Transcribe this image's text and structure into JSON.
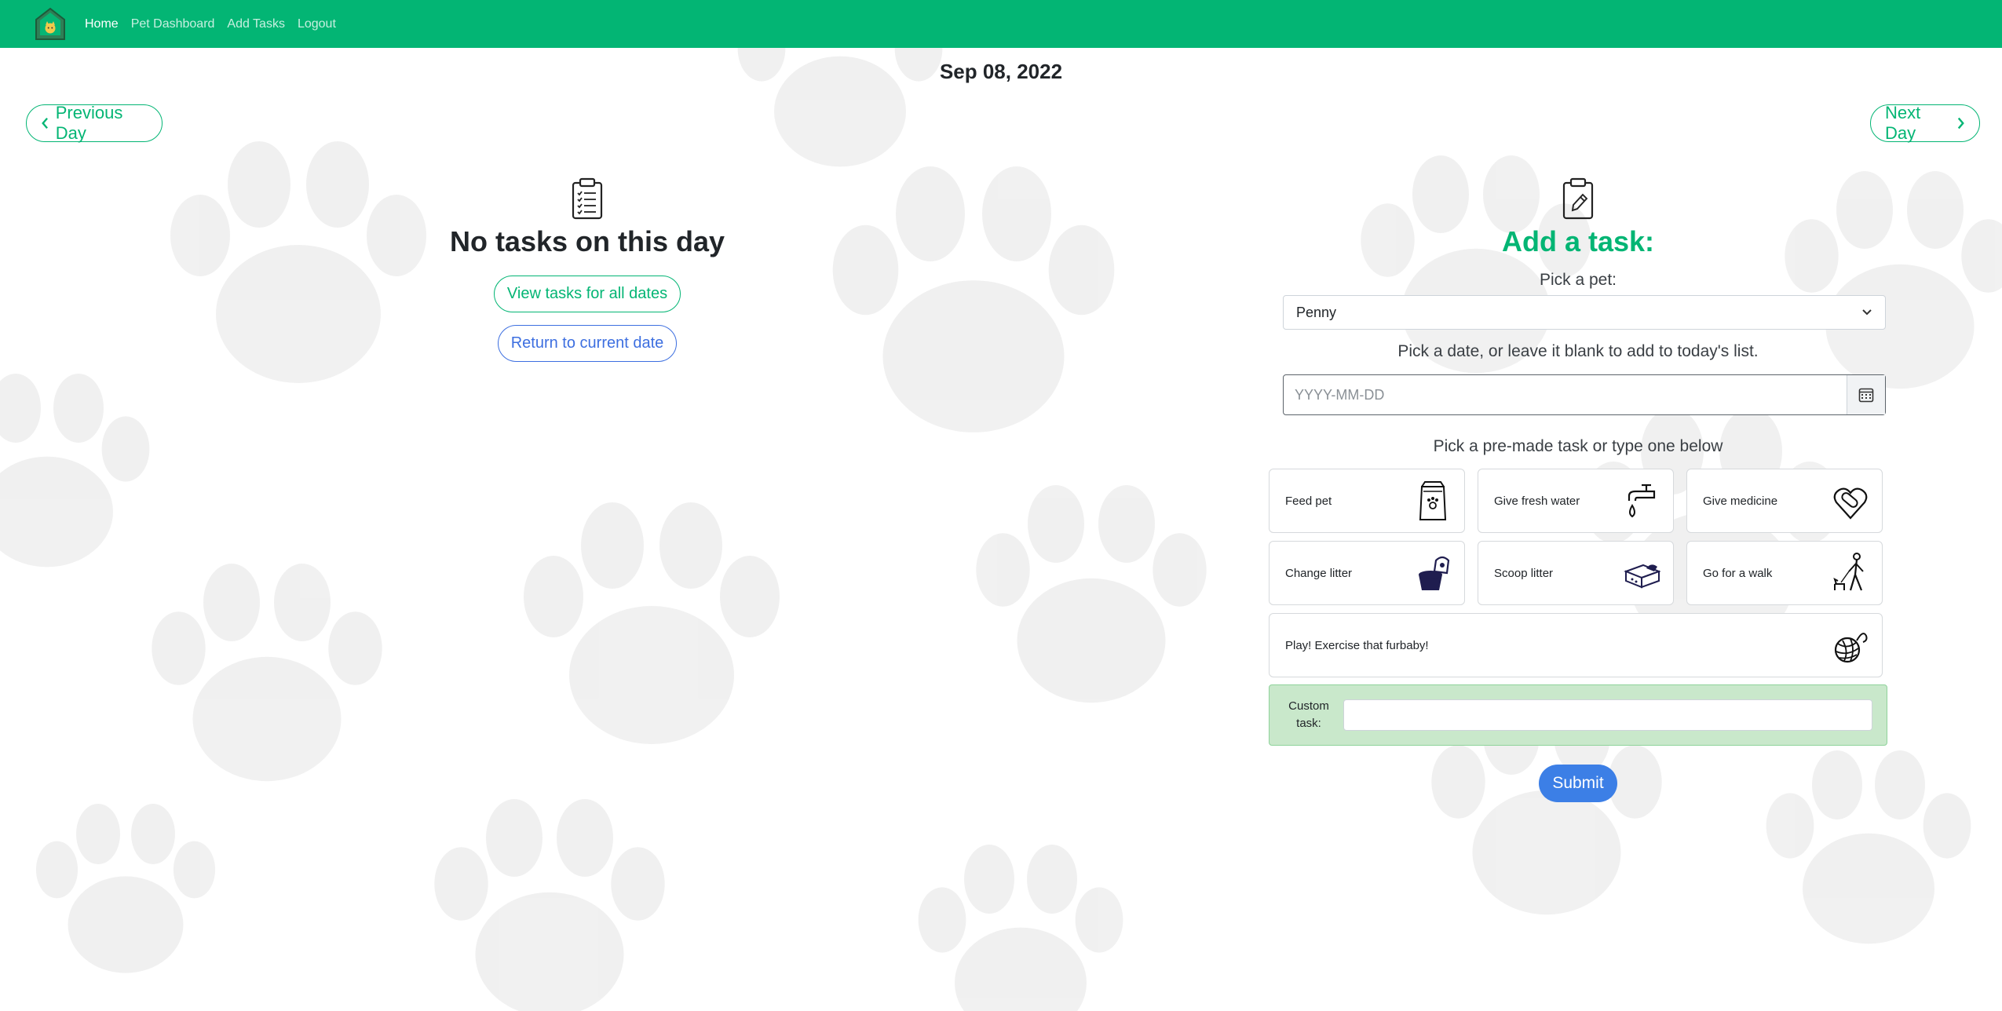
{
  "navbar": {
    "links": [
      {
        "label": "Home",
        "active": true
      },
      {
        "label": "Pet Dashboard",
        "active": false
      },
      {
        "label": "Add Tasks",
        "active": false
      },
      {
        "label": "Logout",
        "active": false
      }
    ],
    "color": "#03b574"
  },
  "day": {
    "date": "Sep 08, 2022",
    "prev_label": "Previous Day",
    "next_label": "Next Day"
  },
  "tasks_panel": {
    "empty_heading": "No tasks on this day",
    "view_all_label": "View tasks for all dates",
    "return_label": "Return to current date"
  },
  "add_task": {
    "heading": "Add a task:",
    "pet_label": "Pick a pet:",
    "pet_selected": "Penny",
    "date_label": "Pick a date, or leave it blank to add to today's list.",
    "date_placeholder": "YYYY-MM-DD",
    "premade_label": "Pick a pre-made task or type one below",
    "premade_tasks": [
      {
        "label": "Feed pet",
        "icon": "pet-food-bag-icon"
      },
      {
        "label": "Give fresh water",
        "icon": "water-faucet-icon"
      },
      {
        "label": "Give medicine",
        "icon": "medicine-pill-icon"
      },
      {
        "label": "Change litter",
        "icon": "litter-bag-icon"
      },
      {
        "label": "Scoop litter",
        "icon": "litter-box-icon"
      },
      {
        "label": "Go for a walk",
        "icon": "dog-walk-icon"
      },
      {
        "label": "Play! Exercise that furbaby!",
        "icon": "yarn-ball-icon"
      }
    ],
    "custom_label": "Custom task:",
    "submit_label": "Submit"
  },
  "colors": {
    "accent_green": "#03b574",
    "blue": "#3d6fe0",
    "submit_blue": "#3c7fe6",
    "custom_bg": "#c9e8cb"
  }
}
